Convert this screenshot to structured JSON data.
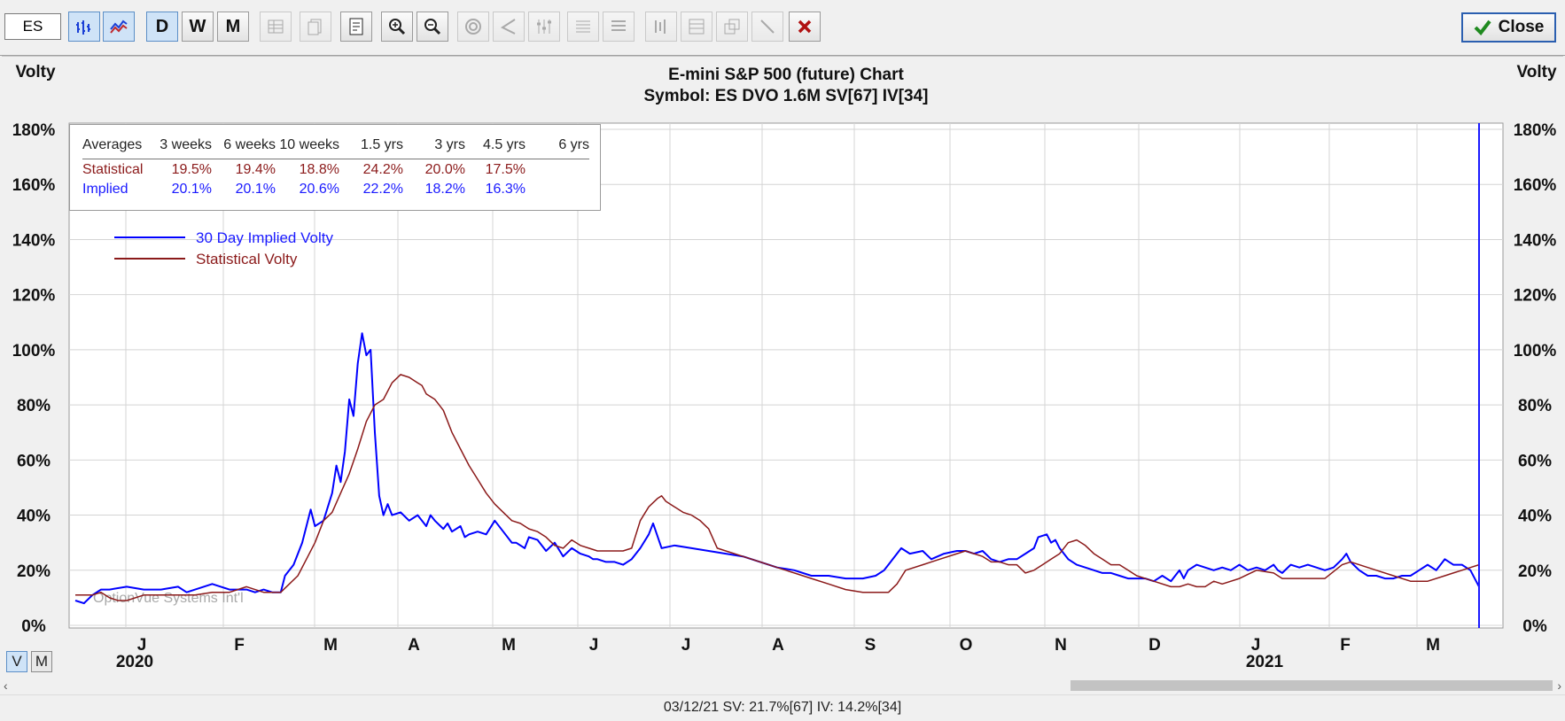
{
  "toolbar": {
    "symbol_value": "ES",
    "period_buttons": [
      "D",
      "W",
      "M"
    ],
    "close_label": "Close"
  },
  "chart": {
    "title": "E-mini S&P 500 (future) Chart",
    "subtitle": "Symbol: ES  DVO 1.6M  SV[67]  IV[34]",
    "left_axis_label": "Volty",
    "right_axis_label": "Volty",
    "watermark": "OptionVue Systems Int'l",
    "y_ticks": [
      "0%",
      "20%",
      "40%",
      "60%",
      "80%",
      "100%",
      "120%",
      "140%",
      "160%",
      "180%"
    ],
    "month_labels": [
      "J",
      "F",
      "M",
      "A",
      "M",
      "J",
      "J",
      "A",
      "S",
      "O",
      "N",
      "D",
      "J",
      "F",
      "M"
    ],
    "year_labels": [
      "2020",
      "2021"
    ]
  },
  "averages": {
    "headers": [
      "Averages",
      "3 weeks",
      "6 weeks",
      "10 weeks",
      "1.5 yrs",
      "3 yrs",
      "4.5 yrs",
      "6 yrs"
    ],
    "statistical": [
      "Statistical",
      "19.5%",
      "19.4%",
      "18.8%",
      "24.2%",
      "20.0%",
      "17.5%",
      ""
    ],
    "implied": [
      "Implied",
      "20.1%",
      "20.1%",
      "20.6%",
      "22.2%",
      "18.2%",
      "16.3%",
      ""
    ]
  },
  "legend": {
    "implied_label": "30 Day Implied Volty",
    "statistical_label": "Statistical Volty",
    "implied_color": "#0000ff",
    "statistical_color": "#8b1a1a"
  },
  "view_toggle": {
    "v_label": "V",
    "m_label": "M"
  },
  "status": {
    "text": "03/12/21   SV: 21.7%[67]   IV: 14.2%[34]"
  },
  "chart_data": {
    "type": "line",
    "ylim": [
      0,
      180
    ],
    "x_unit": "months since Dec 2019",
    "series": [
      {
        "name": "30 Day Implied Volty",
        "color": "#0000ff",
        "points": [
          [
            0.6,
            9
          ],
          [
            0.7,
            8
          ],
          [
            0.8,
            11
          ],
          [
            0.9,
            13
          ],
          [
            1.0,
            13
          ],
          [
            1.2,
            14
          ],
          [
            1.4,
            13
          ],
          [
            1.6,
            13
          ],
          [
            1.8,
            14
          ],
          [
            1.9,
            12
          ],
          [
            2.0,
            13
          ],
          [
            2.2,
            15
          ],
          [
            2.3,
            14
          ],
          [
            2.4,
            13
          ],
          [
            2.6,
            13
          ],
          [
            2.7,
            12
          ],
          [
            2.8,
            13
          ],
          [
            2.9,
            12
          ],
          [
            3.0,
            12
          ],
          [
            3.05,
            18
          ],
          [
            3.15,
            22
          ],
          [
            3.25,
            30
          ],
          [
            3.35,
            42
          ],
          [
            3.4,
            36
          ],
          [
            3.5,
            38
          ],
          [
            3.6,
            48
          ],
          [
            3.65,
            58
          ],
          [
            3.7,
            52
          ],
          [
            3.75,
            63
          ],
          [
            3.8,
            82
          ],
          [
            3.85,
            76
          ],
          [
            3.9,
            95
          ],
          [
            3.95,
            106
          ],
          [
            4.0,
            98
          ],
          [
            4.05,
            100
          ],
          [
            4.1,
            70
          ],
          [
            4.15,
            47
          ],
          [
            4.2,
            40
          ],
          [
            4.25,
            44
          ],
          [
            4.3,
            40
          ],
          [
            4.4,
            41
          ],
          [
            4.5,
            38
          ],
          [
            4.6,
            40
          ],
          [
            4.7,
            36
          ],
          [
            4.75,
            40
          ],
          [
            4.8,
            38
          ],
          [
            4.9,
            35
          ],
          [
            4.95,
            37
          ],
          [
            5.0,
            34
          ],
          [
            5.1,
            36
          ],
          [
            5.15,
            32
          ],
          [
            5.2,
            33
          ],
          [
            5.3,
            34
          ],
          [
            5.4,
            33
          ],
          [
            5.5,
            38
          ],
          [
            5.6,
            34
          ],
          [
            5.7,
            30
          ],
          [
            5.75,
            30
          ],
          [
            5.85,
            28
          ],
          [
            5.9,
            32
          ],
          [
            6.0,
            31
          ],
          [
            6.1,
            27
          ],
          [
            6.2,
            30
          ],
          [
            6.3,
            25
          ],
          [
            6.4,
            28
          ],
          [
            6.5,
            26
          ],
          [
            6.6,
            25
          ],
          [
            6.65,
            24
          ],
          [
            6.7,
            24
          ],
          [
            6.8,
            23
          ],
          [
            6.9,
            23
          ],
          [
            7.0,
            22
          ],
          [
            7.1,
            24
          ],
          [
            7.2,
            28
          ],
          [
            7.3,
            33
          ],
          [
            7.35,
            37
          ],
          [
            7.45,
            28
          ],
          [
            7.6,
            29
          ],
          [
            7.8,
            28
          ],
          [
            8.0,
            27
          ],
          [
            8.2,
            26
          ],
          [
            8.4,
            25
          ],
          [
            8.6,
            23
          ],
          [
            8.8,
            21
          ],
          [
            9.0,
            20
          ],
          [
            9.2,
            18
          ],
          [
            9.4,
            18
          ],
          [
            9.6,
            17
          ],
          [
            9.8,
            17
          ],
          [
            9.95,
            18
          ],
          [
            10.05,
            20
          ],
          [
            10.15,
            24
          ],
          [
            10.25,
            28
          ],
          [
            10.35,
            26
          ],
          [
            10.5,
            27
          ],
          [
            10.6,
            24
          ],
          [
            10.75,
            26
          ],
          [
            10.9,
            27
          ],
          [
            11.0,
            27
          ],
          [
            11.1,
            26
          ],
          [
            11.2,
            27
          ],
          [
            11.3,
            24
          ],
          [
            11.4,
            23
          ],
          [
            11.5,
            24
          ],
          [
            11.6,
            24
          ],
          [
            11.7,
            26
          ],
          [
            11.8,
            28
          ],
          [
            11.85,
            32
          ],
          [
            11.95,
            33
          ],
          [
            12.0,
            30
          ],
          [
            12.05,
            31
          ],
          [
            12.1,
            28
          ],
          [
            12.2,
            24
          ],
          [
            12.3,
            22
          ],
          [
            12.4,
            21
          ],
          [
            12.5,
            20
          ],
          [
            12.6,
            19
          ],
          [
            12.7,
            19
          ],
          [
            12.8,
            18
          ],
          [
            12.9,
            17
          ],
          [
            13.0,
            17
          ],
          [
            13.1,
            17
          ],
          [
            13.2,
            16
          ],
          [
            13.3,
            18
          ],
          [
            13.4,
            16
          ],
          [
            13.5,
            20
          ],
          [
            13.55,
            17
          ],
          [
            13.6,
            20
          ],
          [
            13.7,
            22
          ],
          [
            13.8,
            21
          ],
          [
            13.9,
            20
          ],
          [
            14.0,
            21
          ],
          [
            14.1,
            20
          ],
          [
            14.2,
            22
          ],
          [
            14.3,
            20
          ],
          [
            14.4,
            21
          ],
          [
            14.5,
            20
          ],
          [
            14.6,
            22
          ],
          [
            14.65,
            20
          ],
          [
            14.7,
            19
          ],
          [
            14.8,
            22
          ],
          [
            14.9,
            21
          ],
          [
            15.0,
            22
          ],
          [
            15.1,
            21
          ],
          [
            15.2,
            20
          ],
          [
            15.3,
            21
          ],
          [
            15.4,
            24
          ],
          [
            15.45,
            26
          ],
          [
            15.5,
            23
          ],
          [
            15.6,
            20
          ],
          [
            15.7,
            18
          ],
          [
            15.8,
            18
          ],
          [
            15.9,
            17
          ],
          [
            16.0,
            17
          ],
          [
            16.1,
            18
          ],
          [
            16.2,
            18
          ],
          [
            16.3,
            20
          ],
          [
            16.4,
            22
          ],
          [
            16.5,
            20
          ],
          [
            16.6,
            24
          ],
          [
            16.7,
            22
          ],
          [
            16.8,
            22
          ],
          [
            16.9,
            20
          ],
          [
            17.0,
            14
          ]
        ]
      },
      {
        "name": "Statistical Volty",
        "color": "#8b1a1a",
        "points": [
          [
            0.6,
            11
          ],
          [
            0.8,
            11
          ],
          [
            0.9,
            12
          ],
          [
            1.0,
            10
          ],
          [
            1.1,
            9
          ],
          [
            1.2,
            9
          ],
          [
            1.4,
            11
          ],
          [
            1.6,
            11
          ],
          [
            1.8,
            11
          ],
          [
            2.0,
            11
          ],
          [
            2.2,
            12
          ],
          [
            2.4,
            12
          ],
          [
            2.6,
            14
          ],
          [
            2.7,
            13
          ],
          [
            2.8,
            12
          ],
          [
            2.9,
            12
          ],
          [
            3.0,
            12
          ],
          [
            3.1,
            15
          ],
          [
            3.2,
            18
          ],
          [
            3.3,
            24
          ],
          [
            3.4,
            30
          ],
          [
            3.5,
            38
          ],
          [
            3.6,
            41
          ],
          [
            3.7,
            48
          ],
          [
            3.8,
            55
          ],
          [
            3.9,
            64
          ],
          [
            4.0,
            74
          ],
          [
            4.1,
            80
          ],
          [
            4.2,
            82
          ],
          [
            4.3,
            88
          ],
          [
            4.4,
            91
          ],
          [
            4.5,
            90
          ],
          [
            4.6,
            88
          ],
          [
            4.65,
            87
          ],
          [
            4.7,
            84
          ],
          [
            4.8,
            82
          ],
          [
            4.85,
            80
          ],
          [
            4.9,
            78
          ],
          [
            5.0,
            70
          ],
          [
            5.1,
            64
          ],
          [
            5.2,
            58
          ],
          [
            5.3,
            53
          ],
          [
            5.4,
            48
          ],
          [
            5.5,
            44
          ],
          [
            5.6,
            41
          ],
          [
            5.7,
            38
          ],
          [
            5.8,
            37
          ],
          [
            5.9,
            35
          ],
          [
            6.0,
            34
          ],
          [
            6.1,
            32
          ],
          [
            6.2,
            29
          ],
          [
            6.3,
            28
          ],
          [
            6.4,
            31
          ],
          [
            6.5,
            29
          ],
          [
            6.6,
            28
          ],
          [
            6.7,
            27
          ],
          [
            6.8,
            27
          ],
          [
            6.9,
            27
          ],
          [
            7.0,
            27
          ],
          [
            7.1,
            28
          ],
          [
            7.2,
            38
          ],
          [
            7.3,
            43
          ],
          [
            7.4,
            46
          ],
          [
            7.45,
            47
          ],
          [
            7.5,
            45
          ],
          [
            7.6,
            43
          ],
          [
            7.7,
            41
          ],
          [
            7.8,
            40
          ],
          [
            7.9,
            38
          ],
          [
            8.0,
            35
          ],
          [
            8.1,
            28
          ],
          [
            8.2,
            27
          ],
          [
            8.4,
            25
          ],
          [
            8.6,
            23
          ],
          [
            8.8,
            21
          ],
          [
            9.0,
            19
          ],
          [
            9.2,
            17
          ],
          [
            9.4,
            15
          ],
          [
            9.6,
            13
          ],
          [
            9.8,
            12
          ],
          [
            10.0,
            12
          ],
          [
            10.1,
            12
          ],
          [
            10.2,
            15
          ],
          [
            10.3,
            20
          ],
          [
            10.5,
            22
          ],
          [
            10.7,
            24
          ],
          [
            10.9,
            26
          ],
          [
            11.0,
            27
          ],
          [
            11.1,
            26
          ],
          [
            11.2,
            25
          ],
          [
            11.3,
            23
          ],
          [
            11.4,
            23
          ],
          [
            11.5,
            22
          ],
          [
            11.6,
            22
          ],
          [
            11.7,
            19
          ],
          [
            11.8,
            20
          ],
          [
            11.9,
            22
          ],
          [
            12.0,
            24
          ],
          [
            12.1,
            26
          ],
          [
            12.2,
            30
          ],
          [
            12.3,
            31
          ],
          [
            12.4,
            29
          ],
          [
            12.5,
            26
          ],
          [
            12.6,
            24
          ],
          [
            12.7,
            22
          ],
          [
            12.8,
            22
          ],
          [
            12.9,
            20
          ],
          [
            13.0,
            18
          ],
          [
            13.2,
            16
          ],
          [
            13.4,
            14
          ],
          [
            13.5,
            14
          ],
          [
            13.6,
            15
          ],
          [
            13.7,
            14
          ],
          [
            13.8,
            14
          ],
          [
            13.9,
            16
          ],
          [
            14.0,
            15
          ],
          [
            14.2,
            17
          ],
          [
            14.4,
            20
          ],
          [
            14.6,
            19
          ],
          [
            14.7,
            17
          ],
          [
            14.8,
            17
          ],
          [
            15.0,
            17
          ],
          [
            15.2,
            17
          ],
          [
            15.4,
            22
          ],
          [
            15.5,
            23
          ],
          [
            15.6,
            22
          ],
          [
            15.8,
            20
          ],
          [
            16.0,
            18
          ],
          [
            16.2,
            16
          ],
          [
            16.4,
            16
          ],
          [
            16.6,
            18
          ],
          [
            16.7,
            19
          ],
          [
            16.8,
            20
          ],
          [
            16.9,
            21
          ],
          [
            17.0,
            22
          ]
        ]
      }
    ]
  }
}
